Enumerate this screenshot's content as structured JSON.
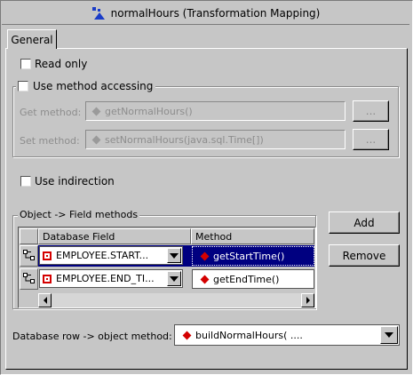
{
  "window": {
    "title": "normalHours (Transformation Mapping)"
  },
  "tabs": [
    {
      "label": "General",
      "selected": true
    }
  ],
  "options": {
    "read_only": {
      "label": "Read only",
      "checked": false
    },
    "use_method_accessing": {
      "label": "Use method accessing",
      "checked": false
    },
    "use_indirection": {
      "label": "Use indirection",
      "checked": false
    }
  },
  "method_accessing": {
    "get_label": "Get method:",
    "get_value": "getNormalHours()",
    "get_button": "...",
    "set_label": "Set method:",
    "set_value": "setNormalHours(java.sql.Time[])",
    "set_button": "..."
  },
  "field_methods": {
    "group_label": "Object -> Field methods",
    "columns": [
      "Database Field",
      "Method"
    ],
    "rows": [
      {
        "field": "EMPLOYEE.START...",
        "method": "getStartTime()",
        "selected": true
      },
      {
        "field": "EMPLOYEE.END_TI...",
        "method": "getEndTime()",
        "selected": false
      }
    ],
    "add_button": "Add",
    "remove_button": "Remove"
  },
  "db_row_method": {
    "label": "Database row -> object method:",
    "value": "buildNormalHours( ...."
  },
  "colors": {
    "background": "#c6c6c6",
    "selection": "#000080",
    "method_icon": "#d40000",
    "disabled_text": "#8d8d8d"
  }
}
